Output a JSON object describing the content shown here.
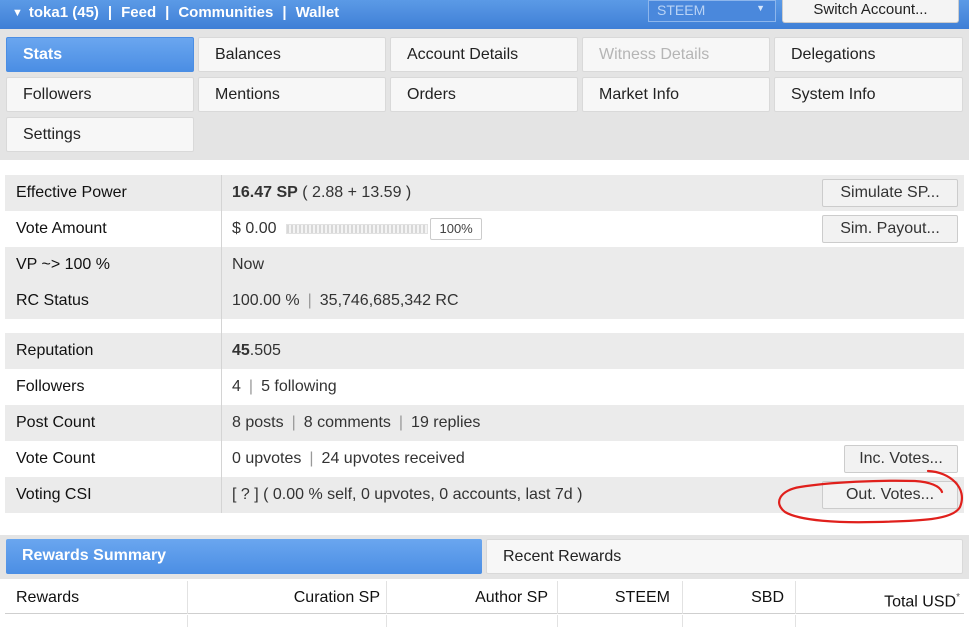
{
  "topbar": {
    "account": "toka1 (45)",
    "nav": [
      "Feed",
      "Communities",
      "Wallet"
    ],
    "chain_select": "STEEM",
    "switch_account": "Switch Account..."
  },
  "tabs": [
    {
      "label": "Stats",
      "state": "active"
    },
    {
      "label": "Balances",
      "state": "normal"
    },
    {
      "label": "Account Details",
      "state": "normal"
    },
    {
      "label": "Witness Details",
      "state": "disabled"
    },
    {
      "label": "Delegations",
      "state": "normal"
    },
    {
      "label": "Followers",
      "state": "normal"
    },
    {
      "label": "Mentions",
      "state": "normal"
    },
    {
      "label": "Orders",
      "state": "normal"
    },
    {
      "label": "Market Info",
      "state": "normal"
    },
    {
      "label": "System Info",
      "state": "normal"
    },
    {
      "label": "Settings",
      "state": "normal"
    }
  ],
  "stats": {
    "effective_power": {
      "label": "Effective Power",
      "value_bold": "16.47 SP",
      "value_rest": " ( 2.88 + 13.59 )",
      "button": "Simulate SP..."
    },
    "vote_amount": {
      "label": "Vote Amount",
      "value": "$ 0.00",
      "percent": "100%",
      "button": "Sim. Payout..."
    },
    "vp": {
      "label": "VP ~> 100 %",
      "value": "Now"
    },
    "rc_status": {
      "label": "RC Status",
      "pct": "100.00 %",
      "rc": "35,746,685,342 RC"
    },
    "reputation": {
      "label": "Reputation",
      "value_bold": "45",
      "value_rest": ".505"
    },
    "followers": {
      "label": "Followers",
      "count": "4",
      "following": "5 following"
    },
    "post_count": {
      "label": "Post Count",
      "posts": "8 posts",
      "comments": "8 comments",
      "replies": "19 replies"
    },
    "vote_count": {
      "label": "Vote Count",
      "upvotes": "0 upvotes",
      "received": "24 upvotes received",
      "button": "Inc. Votes..."
    },
    "voting_csi": {
      "label": "Voting CSI",
      "value": "[ ? ] ( 0.00 % self, 0 upvotes, 0 accounts, last 7d )",
      "button": "Out. Votes..."
    }
  },
  "rewards": {
    "tabs": [
      {
        "label": "Rewards Summary",
        "state": "active"
      },
      {
        "label": "Recent Rewards",
        "state": "normal"
      }
    ],
    "headers": [
      "Rewards",
      "Curation SP",
      "Author SP",
      "STEEM",
      "SBD",
      "Total USD"
    ],
    "total_marker": "*"
  },
  "colors": {
    "accent": "#4b8ee4",
    "annotation": "#e0201c",
    "row_alt": "#ebebeb"
  }
}
